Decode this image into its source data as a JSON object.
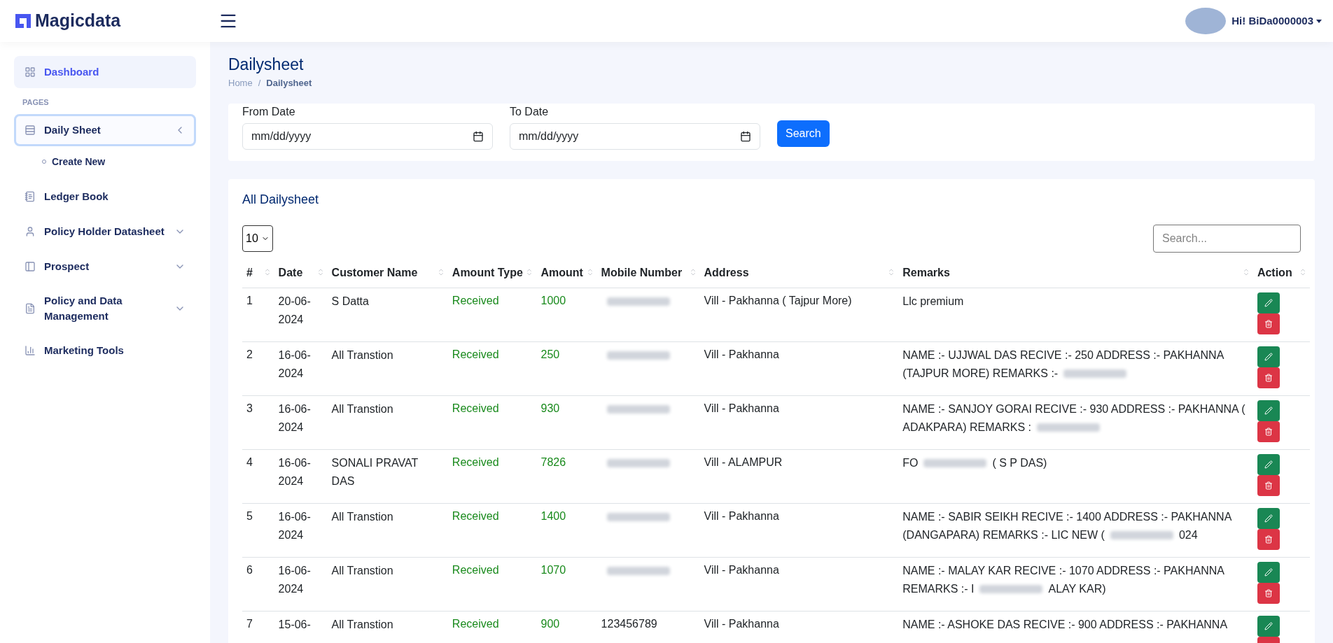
{
  "header": {
    "logo": "Magicdata",
    "user": "Hi! BiDa0000003"
  },
  "sidebar": {
    "items": [
      {
        "label": "Dashboard",
        "selected": true,
        "focused": false
      },
      {
        "kind": "heading",
        "label": "PAGES"
      },
      {
        "label": "Daily Sheet",
        "selected": false,
        "focused": true,
        "expanded": true,
        "children": [
          {
            "label": "Create New"
          }
        ]
      },
      {
        "label": "Ledger Book",
        "selected": false,
        "focused": false
      },
      {
        "label": "Policy Holder Datasheet",
        "selected": false,
        "focused": false,
        "expanded": false
      },
      {
        "label": "Prospect",
        "selected": false,
        "focused": false,
        "expanded": false
      },
      {
        "label": "Policy and Data Management",
        "selected": false,
        "focused": false,
        "expanded": false
      },
      {
        "label": "Marketing Tools",
        "selected": false,
        "focused": false
      }
    ]
  },
  "page": {
    "title": "Dailysheet",
    "breadcrumb": [
      "Home",
      "Dailysheet"
    ],
    "breadcrumb_separator": "/"
  },
  "filter": {
    "from_label": "From Date",
    "from_placeholder": "mm/dd/yyyy",
    "to_label": "To Date",
    "to_placeholder": "mm/dd/yyyy",
    "button": "Search"
  },
  "table_card": {
    "title": "All Dailysheet",
    "page_size": "10",
    "search_placeholder": "Search...",
    "columns": [
      "#",
      "Date",
      "Customer Name",
      "Amount Type",
      "Amount",
      "Mobile Number",
      "Address",
      "Remarks",
      "Action"
    ],
    "rows": [
      {
        "index": "1",
        "date": "20-06-2024",
        "customer": "S Datta",
        "amount_type": "Received",
        "amount": "1000",
        "mobile": {
          "redacted": true
        },
        "address": "Vill - Pakhanna ( Tajpur More)",
        "remarks": [
          [
            {
              "kind": "text",
              "text": "Llc premium"
            }
          ]
        ]
      },
      {
        "index": "2",
        "date": "16-06-2024",
        "customer": "All Transtion",
        "amount_type": "Received",
        "amount": "250",
        "mobile": {
          "redacted": true
        },
        "address": "Vill - Pakhanna",
        "remarks": [
          [
            {
              "kind": "text",
              "text": "NAME :- UJJWAL DAS RECIVE :- 250 ADDRESS :- PAKHANNA"
            }
          ],
          [
            {
              "kind": "text",
              "text": "(TAJPUR MORE) REMARKS :-"
            },
            {
              "kind": "redacted"
            }
          ]
        ]
      },
      {
        "index": "3",
        "date": "16-06-2024",
        "customer": "All Transtion",
        "amount_type": "Received",
        "amount": "930",
        "mobile": {
          "redacted": true
        },
        "address": "Vill - Pakhanna",
        "remarks": [
          [
            {
              "kind": "text",
              "text": "NAME :- SANJOY GORAI RECIVE :- 930 ADDRESS :- PAKHANNA ("
            }
          ],
          [
            {
              "kind": "text",
              "text": "ADAKPARA) REMARKS :"
            },
            {
              "kind": "redacted"
            }
          ]
        ]
      },
      {
        "index": "4",
        "date": "16-06-2024",
        "customer": "SONALI PRAVAT DAS",
        "amount_type": "Received",
        "amount": "7826",
        "mobile": {
          "redacted": true
        },
        "address": "Vill - ALAMPUR",
        "remarks": [
          [
            {
              "kind": "text",
              "text": "FO"
            },
            {
              "kind": "redacted"
            },
            {
              "kind": "text",
              "text": "( S P DAS)"
            }
          ]
        ]
      },
      {
        "index": "5",
        "date": "16-06-2024",
        "customer": "All Transtion",
        "amount_type": "Received",
        "amount": "1400",
        "mobile": {
          "redacted": true
        },
        "address": "Vill - Pakhanna",
        "remarks": [
          [
            {
              "kind": "text",
              "text": "NAME :- SABIR SEIKH RECIVE :- 1400 ADDRESS :- PAKHANNA"
            }
          ],
          [
            {
              "kind": "text",
              "text": "(DANGAPARA) REMARKS :- LIC NEW ("
            },
            {
              "kind": "redacted"
            },
            {
              "kind": "text",
              "text": "024"
            }
          ]
        ]
      },
      {
        "index": "6",
        "date": "16-06-2024",
        "customer": "All Transtion",
        "amount_type": "Received",
        "amount": "1070",
        "mobile": {
          "redacted": true
        },
        "address": "Vill - Pakhanna",
        "remarks": [
          [
            {
              "kind": "text",
              "text": "NAME :- MALAY KAR RECIVE :- 1070 ADDRESS :- PAKHANNA"
            }
          ],
          [
            {
              "kind": "text",
              "text": "REMARKS :- I"
            },
            {
              "kind": "redacted"
            },
            {
              "kind": "text",
              "text": "ALAY KAR)"
            }
          ]
        ]
      },
      {
        "index": "7",
        "date": "15-06-",
        "customer": "All Transtion",
        "amount_type": "Received",
        "amount": "900",
        "mobile": {
          "redacted": false,
          "value": "123456789"
        },
        "address": "Vill - Pakhanna",
        "remarks": [
          [
            {
              "kind": "text",
              "text": "NAME :- ASHOKE DAS RECIVE :- 900 ADDRESS :- PAKHANNA"
            }
          ]
        ]
      }
    ]
  }
}
